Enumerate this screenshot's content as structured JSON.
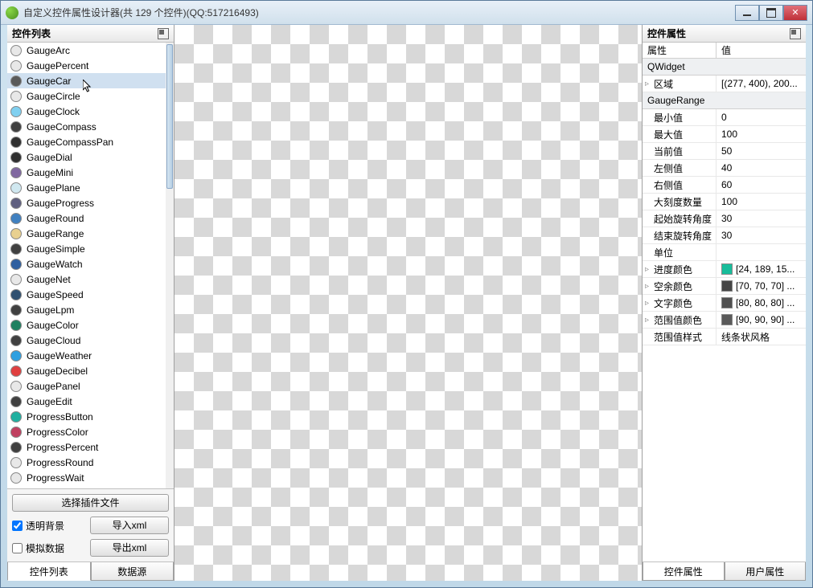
{
  "window": {
    "title": "自定义控件属性设计器(共 129 个控件)(QQ:517216493)"
  },
  "left_panel": {
    "header": "控件列表",
    "items": [
      {
        "label": "GaugeArc",
        "color": "#e8e8e8"
      },
      {
        "label": "GaugePercent",
        "color": "#e8e8e8"
      },
      {
        "label": "GaugeCar",
        "color": "#5a5a5a",
        "selected": true
      },
      {
        "label": "GaugeCircle",
        "color": "#e8e8e8"
      },
      {
        "label": "GaugeClock",
        "color": "#80d0f0"
      },
      {
        "label": "GaugeCompass",
        "color": "#404040"
      },
      {
        "label": "GaugeCompassPan",
        "color": "#303030"
      },
      {
        "label": "GaugeDial",
        "color": "#303030"
      },
      {
        "label": "GaugeMini",
        "color": "#8068a0"
      },
      {
        "label": "GaugePlane",
        "color": "#d0e8f0"
      },
      {
        "label": "GaugeProgress",
        "color": "#606080"
      },
      {
        "label": "GaugeRound",
        "color": "#4080c0"
      },
      {
        "label": "GaugeRange",
        "color": "#e8d090"
      },
      {
        "label": "GaugeSimple",
        "color": "#404040"
      },
      {
        "label": "GaugeWatch",
        "color": "#3060a0"
      },
      {
        "label": "GaugeNet",
        "color": "#e8e8e8"
      },
      {
        "label": "GaugeSpeed",
        "color": "#305070"
      },
      {
        "label": "GaugeLpm",
        "color": "#404040"
      },
      {
        "label": "GaugeColor",
        "color": "#208060"
      },
      {
        "label": "GaugeCloud",
        "color": "#404040"
      },
      {
        "label": "GaugeWeather",
        "color": "#30a0e0"
      },
      {
        "label": "GaugeDecibel",
        "color": "#e04040"
      },
      {
        "label": "GaugePanel",
        "color": "#e8e8e8"
      },
      {
        "label": "GaugeEdit",
        "color": "#404040"
      },
      {
        "label": "ProgressButton",
        "color": "#20b0a0"
      },
      {
        "label": "ProgressColor",
        "color": "#c04060"
      },
      {
        "label": "ProgressPercent",
        "color": "#404040"
      },
      {
        "label": "ProgressRound",
        "color": "#e8e8e8"
      },
      {
        "label": "ProgressWait",
        "color": "#e8e8e8"
      }
    ],
    "select_plugin_btn": "选择插件文件",
    "transparent_bg": "透明背景",
    "transparent_checked": true,
    "mock_data": "模拟数据",
    "mock_checked": false,
    "import_xml": "导入xml",
    "export_xml": "导出xml",
    "tab_list": "控件列表",
    "tab_data": "数据源"
  },
  "right_panel": {
    "header": "控件属性",
    "col1": "属性",
    "col2": "值",
    "group1": "QWidget",
    "region_label": "区域",
    "region_value": "[(277, 400), 200...",
    "group2": "GaugeRange",
    "rows": [
      {
        "label": "最小值",
        "value": "0"
      },
      {
        "label": "最大值",
        "value": "100"
      },
      {
        "label": "当前值",
        "value": "50"
      },
      {
        "label": "左侧值",
        "value": "40"
      },
      {
        "label": "右侧值",
        "value": "60"
      },
      {
        "label": "大刻度数量",
        "value": "100"
      },
      {
        "label": "起始旋转角度",
        "value": "30"
      },
      {
        "label": "结束旋转角度",
        "value": "30"
      },
      {
        "label": "单位",
        "value": ""
      }
    ],
    "color_rows": [
      {
        "label": "进度颜色",
        "value": "[24, 189, 15...",
        "swatch": "#18bd9b",
        "exp": true
      },
      {
        "label": "空余颜色",
        "value": "[70, 70, 70] ...",
        "swatch": "#464646",
        "exp": true
      },
      {
        "label": "文字颜色",
        "value": "[80, 80, 80] ...",
        "swatch": "#505050",
        "exp": true
      },
      {
        "label": "范围值颜色",
        "value": "[90, 90, 90] ...",
        "swatch": "#5a5a5a",
        "exp": true
      }
    ],
    "style_label": "范围值样式",
    "style_value": "线条状风格",
    "tab_ctrl": "控件属性",
    "tab_user": "用户属性"
  }
}
